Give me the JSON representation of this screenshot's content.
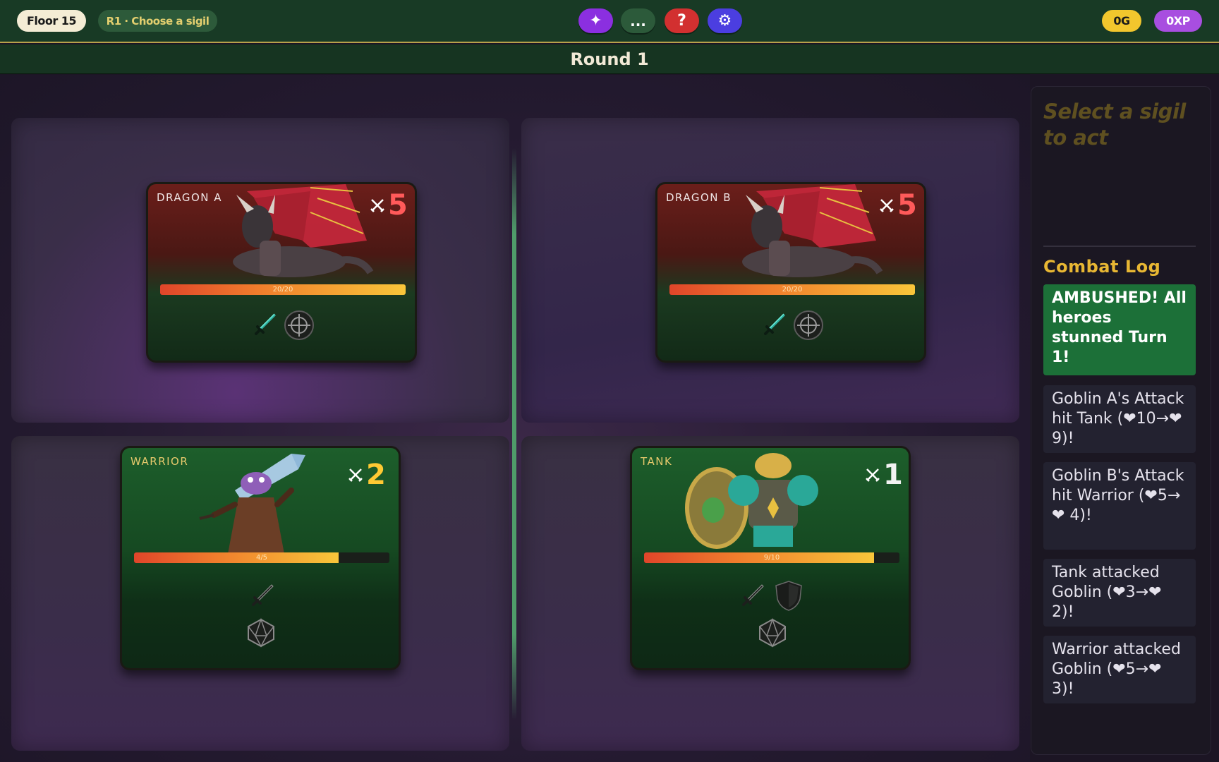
{
  "topbar": {
    "floor": "Floor 15",
    "phase": "R1 · Choose a sigil",
    "gold": "0G",
    "xp": "0XP",
    "buttons": {
      "sparkle": "✦",
      "more": "...",
      "help": "?",
      "settings": "⚙"
    }
  },
  "round": "Round 1",
  "enemies": [
    {
      "name": "DRAGON A",
      "attack": "5",
      "hp_text": "20/20",
      "hp_fraction": 1.0,
      "sigils": [
        "sword-icon",
        "target-icon"
      ]
    },
    {
      "name": "DRAGON B",
      "attack": "5",
      "hp_text": "20/20",
      "hp_fraction": 1.0,
      "sigils": [
        "sword-icon",
        "target-icon"
      ]
    }
  ],
  "heroes": [
    {
      "name": "WARRIOR",
      "attack": "2",
      "hp_text": "4/5",
      "hp_fraction": 0.8,
      "sigils": [
        "sword-icon",
        "d20-icon"
      ]
    },
    {
      "name": "TANK",
      "attack": "1",
      "hp_text": "9/10",
      "hp_fraction": 0.9,
      "sigils": [
        "sword-icon",
        "shield-icon",
        "d20-icon"
      ]
    }
  ],
  "panel": {
    "prompt": "Select a sigil to act",
    "log_title": "Combat Log",
    "log": [
      "AMBUSHED! All heroes stunned Turn 1!",
      "Goblin A's Attack hit Tank (❤10→❤9)!",
      "Goblin B's Attack hit Warrior (❤5→❤ 4)!",
      "Tank attacked Goblin (❤3→❤ 2)!",
      "Warrior attacked Goblin (❤5→❤ 3)!"
    ]
  },
  "colors": {
    "enemy_attack": "#ff5a5a",
    "hero_attack": "#ffc933",
    "log_highlight": "#1c7038",
    "accent_gold": "#e8b733"
  }
}
